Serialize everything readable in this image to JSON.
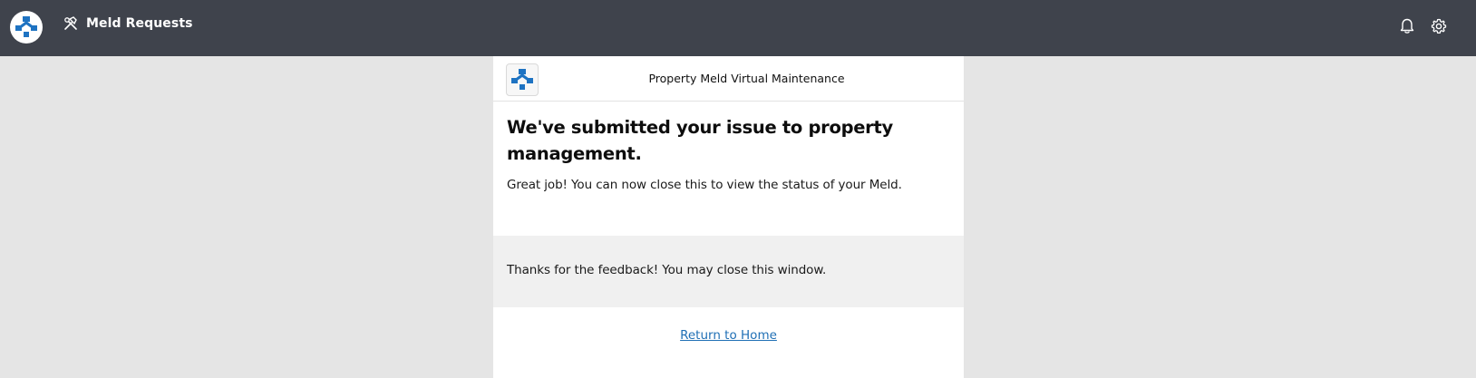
{
  "topbar": {
    "logo_icon": "property-meld-logo-icon",
    "nav_icon": "hammer-wrench-icon",
    "title": "Meld Requests",
    "bell_icon": "bell-icon",
    "gear_icon": "gear-icon",
    "background": "#3f434c"
  },
  "panel": {
    "header_title": "Property Meld Virtual Maintenance",
    "headline": "We've submitted your issue to property management.",
    "subtext": "Great job! You can now close this to view the status of your Meld.",
    "feedback_text": "Thanks for the feedback! You may close this window.",
    "return_link": "Return to Home"
  },
  "colors": {
    "brand_blue": "#1e73c2",
    "link": "#1f6fb5",
    "page_bg": "#e5e5e5",
    "feedback_bg": "#f0f0f0"
  }
}
